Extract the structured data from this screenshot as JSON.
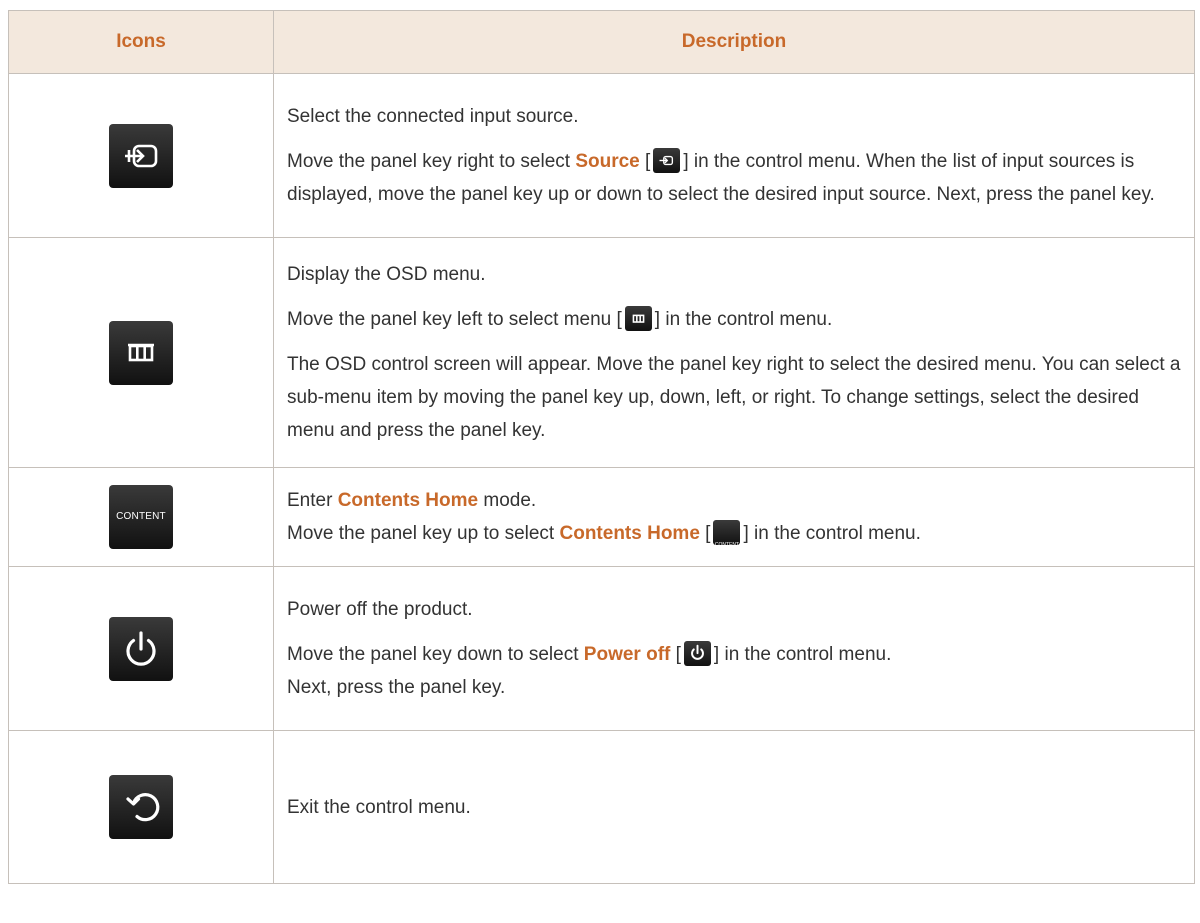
{
  "header": {
    "icons": "Icons",
    "description": "Description"
  },
  "rows": {
    "source": {
      "icon": "source-icon",
      "line1": "Select the connected input source.",
      "p2_a": "Move the panel key right to select ",
      "p2_b": "Source",
      "p2_c": " [",
      "p2_d": "] in the control menu. When the list of input sources is displayed, move the panel key up or down to select the desired input source. Next, press the panel key."
    },
    "menu": {
      "icon": "menu-icon",
      "line1": "Display the OSD menu.",
      "p2_a": "Move the panel key left to select menu [",
      "p2_b": "] in the control menu.",
      "p3": "The OSD control screen will appear. Move the panel key right to select the desired menu. You can select a sub-menu item by moving the panel key up, down, left, or right. To change settings, select the desired menu and press the panel key."
    },
    "content": {
      "icon": "content-icon",
      "icon_text": "CONTENT",
      "p1_a": "Enter ",
      "p1_b": "Contents Home",
      "p1_c": " mode.",
      "p2_a": "Move the panel key up to select ",
      "p2_b": "Contents Home",
      "p2_c": " [",
      "p2_d": "] in the control menu."
    },
    "power": {
      "icon": "power-icon",
      "line1": "Power off the product.",
      "p2_a": "Move the panel key down to select ",
      "p2_b": "Power off",
      "p2_c": " [",
      "p2_d": "] in the control menu.",
      "p2_e": "Next, press the panel key."
    },
    "return": {
      "icon": "return-icon",
      "line1": "Exit the control menu."
    }
  },
  "colors": {
    "accent": "#c8692a",
    "header_bg": "#f3e8dd",
    "border": "#c6c0ba",
    "text": "#333333",
    "button": "#1a1a1a"
  }
}
